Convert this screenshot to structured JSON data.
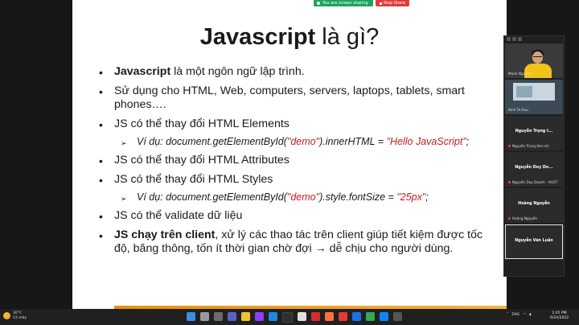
{
  "share_bar": {
    "status": "You are screen sharing",
    "stop": "Stop Share"
  },
  "slide": {
    "title_bold": "Javascript",
    "title_rest": " là gì?",
    "bullets": {
      "b1_bold": "Javascript",
      "b1_rest": " là một ngôn ngữ lập trình.",
      "b2": "Sử dụng cho  HTML, Web, computers, servers, laptops, tablets, smart phones….",
      "b3": "JS có thể thay đổi HTML Elements",
      "b3_sub_a": "Ví dụ: document.getElementById(",
      "b3_sub_str1": "\"demo\"",
      "b3_sub_b": ").innerHTML = ",
      "b3_sub_str2": "\"Hello JavaScript\"",
      "b3_sub_c": ";",
      "b4": "JS có thể thay đổi HTML Attributes",
      "b5": "JS có thể thay đổi HTML Styles",
      "b5_sub_a": "Ví dụ: document.getElementById(",
      "b5_sub_str1": "\"demo\"",
      "b5_sub_b": ").style.fontSize = ",
      "b5_sub_str2": "\"25px\"",
      "b5_sub_c": ";",
      "b6": "JS có thể validate dữ liệu",
      "b7_bold": "JS chạy trên client",
      "b7_rest": ", xử lý các thao tác trên client giúp tiết kiệm được tốc độ, băng thông, tốn ít thời gian chờ đợi → dễ chịu cho người dùng."
    }
  },
  "participants": [
    {
      "label": "Manh Nguyen",
      "type": "video"
    },
    {
      "label": "Binh Ta Huu",
      "type": "camera"
    },
    {
      "center": "Nguyễn Trọng I...",
      "corner": "Nguyễn Trọng lâm-vtc"
    },
    {
      "center": "Nguyễn Duy Do...",
      "corner": "Nguyễn Duy Doanh - HUST"
    },
    {
      "center": "Hoàng Nguyễn",
      "corner": "Hoàng Nguyễn"
    },
    {
      "center": "Nguyễn Văn Luân",
      "corner": ""
    }
  ],
  "taskbar": {
    "temp": "30°C",
    "weather": "Có mây",
    "lang": "ENG",
    "time": "2:45 PM",
    "date": "6/24/2022"
  },
  "colors": {
    "accent_orange": "#f4b23c",
    "string_red": "#c21d1d",
    "share_green": "#1fa35c",
    "stop_red": "#e03b3b"
  }
}
